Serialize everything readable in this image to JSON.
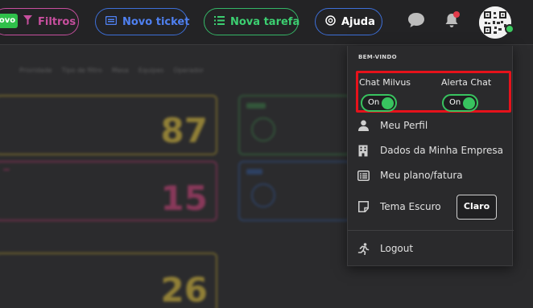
{
  "header": {
    "novo_badge": "ovo",
    "filtros_label": "Filtros",
    "novo_ticket_label": "Novo ticket",
    "nova_tarefa_label": "Nova tarefa",
    "ajuda_label": "Ajuda",
    "colors": {
      "filtros": "#c74f9e",
      "novo_ticket": "#4f80f0",
      "nova_tarefa": "#3ccf71",
      "notification": "#e23b4b",
      "status": "#3cc95f"
    }
  },
  "background": {
    "filters": [
      "Prioridade",
      "Tipo de filtro",
      "Mesa",
      "Equipes",
      "Operador"
    ],
    "cards": [
      {
        "value": "87",
        "color": "#e3c43f"
      },
      {
        "value": "15",
        "color": "#d5447f"
      },
      {
        "value": "26",
        "color": "#e3c43f"
      }
    ]
  },
  "user_menu": {
    "welcome": "BEM-VINDO",
    "toggles": [
      {
        "label": "Chat Milvus",
        "state": "On"
      },
      {
        "label": "Alerta Chat",
        "state": "On"
      }
    ],
    "items": {
      "perfil": "Meu Perfil",
      "empresa": "Dados da Minha Empresa",
      "plano": "Meu plano/fatura",
      "tema": "Tema Escuro",
      "tema_button": "Claro",
      "logout": "Logout"
    },
    "highlight_color": "#e6121b",
    "toggle_color": "#38c35f"
  }
}
